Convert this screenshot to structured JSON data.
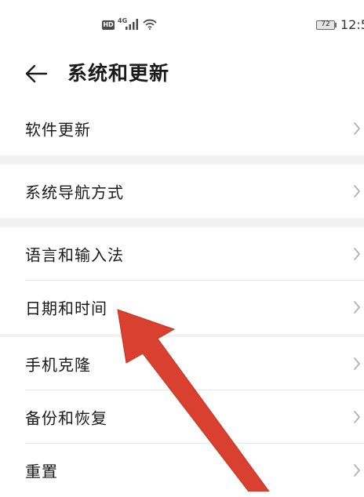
{
  "status_bar": {
    "hd": "HD",
    "network": "4G",
    "battery": "72",
    "time": "12:5"
  },
  "header": {
    "title": "系统和更新"
  },
  "groups": [
    {
      "items": [
        {
          "label": "软件更新"
        }
      ]
    },
    {
      "items": [
        {
          "label": "系统导航方式"
        }
      ]
    },
    {
      "items": [
        {
          "label": "语言和输入法"
        },
        {
          "label": "日期和时间"
        }
      ]
    },
    {
      "items": [
        {
          "label": "手机克隆"
        },
        {
          "label": "备份和恢复"
        },
        {
          "label": "重置"
        }
      ]
    }
  ],
  "annotation": {
    "color": "#d9402f",
    "target": "日期和时间"
  }
}
